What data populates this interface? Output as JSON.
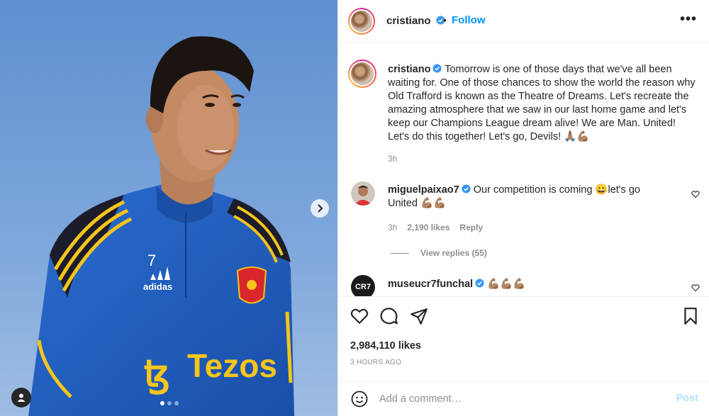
{
  "post": {
    "photo_jersey_number": "7",
    "photo_brand": "adidas",
    "photo_sponsor": "Tezos",
    "carousel": {
      "current": 1,
      "total": 3
    }
  },
  "header": {
    "username": "cristiano",
    "separator": "•",
    "follow_label": "Follow",
    "more_label": "•••"
  },
  "caption": {
    "username": "cristiano",
    "text": "Tomorrow is one of those days that we've all been waiting for. One of those chances to show the world the reason why Old Trafford is known as the Theatre of Dreams. Let's recreate the amazing atmosphere that we saw in our last home game and let's keep our Champions League dream alive! We are Man. United! Let's do this together! Let's go, Devils! 🙏🏽💪🏽",
    "time": "3h"
  },
  "comments": [
    {
      "username": "miguelpaixao7",
      "text": "Our competition is coming 😀let's go United 💪🏽💪🏽",
      "time": "3h",
      "likes": "2,190 likes",
      "reply_label": "Reply",
      "view_replies": "View replies (55)"
    },
    {
      "username": "museucr7funchal",
      "avatar_text": "CR7",
      "text": "💪🏽💪🏽💪🏽"
    }
  ],
  "actions": {
    "likes": "2,984,110 likes",
    "time_ago": "3 HOURS AGO"
  },
  "add_comment": {
    "placeholder": "Add a comment…",
    "post_label": "Post"
  },
  "colors": {
    "accent": "#0095f6",
    "post_disabled": "#b2dffc",
    "secondary_text": "#8e8e8e",
    "jersey_blue": "#1f5fbf",
    "stripe_yellow": "#f7c51b"
  }
}
